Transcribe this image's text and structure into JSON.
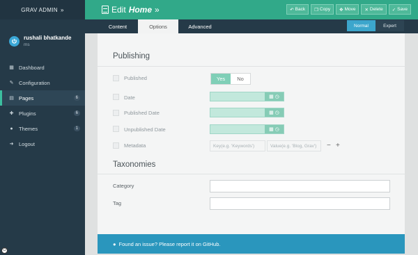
{
  "brand": {
    "name": "GRAV ADMIN",
    "chevron": "»"
  },
  "user": {
    "name": "rushali bhatkande",
    "role": "ms"
  },
  "nav": [
    {
      "label": "Dashboard",
      "icon": "grid-icon",
      "glyph": "▦",
      "count": ""
    },
    {
      "label": "Configuration",
      "icon": "wrench-icon",
      "glyph": "✎",
      "count": ""
    },
    {
      "label": "Pages",
      "icon": "file-icon",
      "glyph": "▤",
      "count": "6"
    },
    {
      "label": "Plugins",
      "icon": "plug-icon",
      "glyph": "✚",
      "count": "6"
    },
    {
      "label": "Themes",
      "icon": "drop-icon",
      "glyph": "●",
      "count": "1"
    },
    {
      "label": "Logout",
      "icon": "signout-icon",
      "glyph": "➜",
      "count": ""
    }
  ],
  "header": {
    "title_prefix": "Edit",
    "title_page": "Home",
    "title_suffix": "»"
  },
  "actions": {
    "back": "Back",
    "copy": "Copy",
    "move": "Move",
    "delete": "Delete",
    "save": "Save"
  },
  "tabs": {
    "content": "Content",
    "options": "Options",
    "advanced": "Advanced"
  },
  "modes": {
    "normal": "Normal",
    "expert": "Expert"
  },
  "publishing": {
    "title": "Publishing",
    "published": "Published",
    "toggle_yes": "Yes",
    "toggle_no": "No",
    "date": "Date",
    "published_date": "Published Date",
    "unpublished_date": "Unpublished Date",
    "metadata": "Metadata",
    "meta_key_placeholder": "Key(e.g. 'Keywords')",
    "meta_value_placeholder": "Value(e.g. 'Blog, Grav')",
    "minus": "−",
    "plus": "+"
  },
  "taxonomies": {
    "title": "Taxonomies",
    "category": "Category",
    "tag": "Tag"
  },
  "footer": {
    "text": "Found an issue? Please report it on GitHub."
  },
  "colors": {
    "sidebar": "#253a48",
    "header": "#31a989",
    "accent_blue": "#2a96bd",
    "active_marker": "#3cbf9f"
  }
}
